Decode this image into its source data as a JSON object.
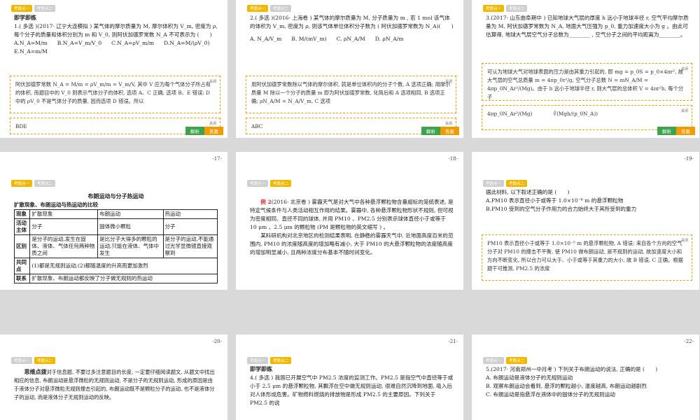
{
  "colors": {
    "tab_active": "#f0b800",
    "tab_inactive": "#cfcfcf",
    "answer_btn": "#f29b00",
    "analysis_btn": "#3fa34d",
    "dashed_border": "#e3a200"
  },
  "slides": [
    {
      "page": "",
      "tabs": [
        "考题点一",
        "考题点二"
      ],
      "heading": "即学即练",
      "question": "1.( 多选 )(2017· 辽宁大连模拟 ) 某气体的摩尔质量为 M, 摩尔体积为 V_m, 密度为 ρ, 每个分子的质量和体积分别为 m 和 V_0, 则阿伏加德罗常数 N_A 不可表示为 (　　)",
      "options": [
        "A.N_A=M/m",
        "B.N_A=V_m/V_0",
        "C.N_A=ρV_m/m",
        "D.N_A=M/(ρV_0)",
        "E.N_A=m/M"
      ],
      "analysis": "阿伏加德罗常数 N_A = M/m = ρV_m/m = V_m/V, 其中 V 应为每个气体分子所占有的体积, 而题目中的 V_0 则表示气体分子的体积, 选项 A、C 正确, 选项 B、E 错误; D 中的 ρV_0 不是气体分子的质量, 因而选项 D 错误。所以",
      "answer": "BDE",
      "close": "关闭",
      "btn_analysis": "解析",
      "btn_answer": "答案"
    },
    {
      "page": "",
      "tabs": [
        "考题点一",
        "考题点二"
      ],
      "question": "2.( 多选 )(2016· 上海卷 ) 某气体的摩尔质量为 M, 分子质量为 m , 若 1 mol 该气体的体积为 V_m, 密度为 ρ, 则该气体单位体积分子数为 ( 阿伏加德罗常数为 N_A)(　　)",
      "options": [
        "A. N_A/V_m",
        "B. M/(mV_m)",
        "C. ρN_A/M",
        "D. ρN_A/m"
      ],
      "analysis": "用阿伏加德罗常数除以气体的摩尔体积, 就是单位体积内的分子个数, A 选项正确; 用摩尔质量 M 除以一个分子的质量 m 即为阿伏加德罗常数, 化简后和 A 选项相同, B 选项正确; ρN_A/M = N_A/V_m, C 选项",
      "answer": "ABC",
      "close": "关闭",
      "btn_analysis": "解析",
      "btn_answer": "答案"
    },
    {
      "page": "",
      "tabs": [
        "考题点一",
        "考题点二"
      ],
      "question": "3.(2017· 山东曲阜期中 ) 已知地球大气层的厚度 h 远小于地球半径 r, 空气平均摩尔质量为 M, 阿伏加德罗常数为 N_A, 地面大气压强为 p_0, 重力加速度大小为 g 。由此可估算得, 地球大气层空气分子总数为________ , 空气分子之间的平均距离为________。",
      "analysis": "可认为地球大气对地球表面的压力是由其重力引起的, 即 mg = p_0S = p_0×4πr², 故大气层的空气总质量 m = 4πp_0r²/g, 空气分子总数 N = mN_A/M = 4πp_0N_Ar²/(Mg)。由于 h 远小于地球半径 r, 则大气层的总体积 V = 4πr²h, 每个分子",
      "answer_left": "4πp_0N_Ar²/(Mg)",
      "answer_right": "∛(Mgh/(p_0N_A))",
      "close": "关闭",
      "btn_analysis": "解析",
      "btn_answer": "答案"
    },
    {
      "page": "-17-",
      "tabs": [
        "考题点一",
        "考题点二"
      ],
      "title": "布朗运动与分子热运动",
      "subtitle": "扩散现象、布朗运动与热运动的比较",
      "table": {
        "header": [
          "现象",
          "扩散现象",
          "布朗运动",
          "热运动"
        ],
        "row_active": [
          "活动主体",
          "分子",
          "固体微小颗粒",
          "分子"
        ],
        "row_diff": [
          "区别",
          "是分子的运动,发生在固体、液体、气体任何两种物质之间",
          "是比分子大得多的颗粒的运动,只能在液体、气体中发生",
          "是分子的运动,不能通过光学显微镜直接观察到"
        ],
        "row_same": [
          "共同点",
          "(1)都是无规则运动;(2)都随温度的升高而更加激烈"
        ],
        "row_link": [
          "联系",
          "扩散现象、布朗运动都反映了分子做无规则的热运动"
        ]
      }
    },
    {
      "page": "-18-",
      "tabs": [
        "考题点一",
        "考题点二"
      ],
      "example_label": "例 2",
      "example_text": "(2016· 北京卷 ) 雾霾天气是对大气中各种悬浮颗粒物含量超标的笼统表述, 是特定气候条件与人类活动相互作用的结果。雾霾中, 各种悬浮颗粒物形状不规则, 但可视为密度相同、直径不同的球体, 并用 PM10 、PM2.5 分别表示球体直径小于或等于 10 μm 、2.5 μm 的颗粒物 (PM 是颗粒物的英文缩写 ) 。",
      "example_text2": "某科研机构对北京地区的检测结果表明, 在静稳的雾霾天气中, 近地面高度百米的范围内, PM10 的浓度随高度的增加略有减小, 大于 PM10 的大悬浮颗粒物的浓度随高度的增加明显减小, 且两种浓度分布基本不随时间变化。"
    },
    {
      "page": "-19-",
      "tabs": [
        "考题点一",
        "考题点二"
      ],
      "question": "据此材料, 以下叙述正确的是 (　　)",
      "optA": "A.PM10 表示直径小于或等于 1.0×10⁻⁶ m 的悬浮颗粒物",
      "optB": "B.PM10 受到的空气分子作用力的合力始终大于其所受到的重力",
      "analysis": "PM10 表示直径小于或等于 1.0×10⁻⁵ m 的悬浮颗粒物, A 错误; 来自各个方向的空气分子对 PM10 的撞击不平衡, 使 PM10 做布朗运动, 是不规则的运动, 故加速度大小和方向不断变化, 所以合力可以大于、小于或等于其重力的大小, 故 B 错误, C 正确。根据题干可推测, PM2.5 的浓度",
      "answer": "C",
      "close": "关闭",
      "btn_analysis": "解析",
      "btn_answer": "答案"
    },
    {
      "page": "-20-",
      "tabs": [
        "考题点一",
        "考题点二"
      ],
      "tip_label": "思维点拨",
      "tip_text": "对于信息题, 不要过多注意题目的长度, 一定要仔细阅读题文, 从题文中找出相应的信息, 布朗运动是悬浮微粒的无规则运动, 不是分子的无规则运动, 形成的原因是由于液体分子对悬浮微粒无规则撞击引起的, 布朗运动既不是颗粒分子的运动, 也不是液体分子的运动, 而是液体分子无规则运动的反映。"
    },
    {
      "page": "-21-",
      "tabs": [
        "考题点一",
        "考题点二"
      ],
      "heading": "即学即练",
      "question": "4.( 多选 ) 我国已开展空气中 PM2.5 浓度的监测工作。PM2.5 是指空气中直径等于或小于 2.5 μm 的悬浮颗粒物, 其飘浮在空中做无规则运动, 很难自然沉降到地面, 吸入后对人体形成危害。矿物燃料燃烧的排放物是形成 PM2.5 的主要原因。下列关于 PM2.5 的说"
    },
    {
      "page": "-22-",
      "tabs": [
        "考题点一",
        "考题点二"
      ],
      "question": "5.(2017· 河南郑州一中月考 ) 下列关于布朗运动的说法, 正确的是 (　　)",
      "optA": "A. 布朗运动是液体分子的无规则运动",
      "optB": "B. 观察布朗运动会看到, 悬浮的颗粒越小, 温度越高, 布朗运动越剧烈",
      "optC": "C. 布朗运动是指悬浮在液体中的固体分子的无规则运动"
    }
  ]
}
